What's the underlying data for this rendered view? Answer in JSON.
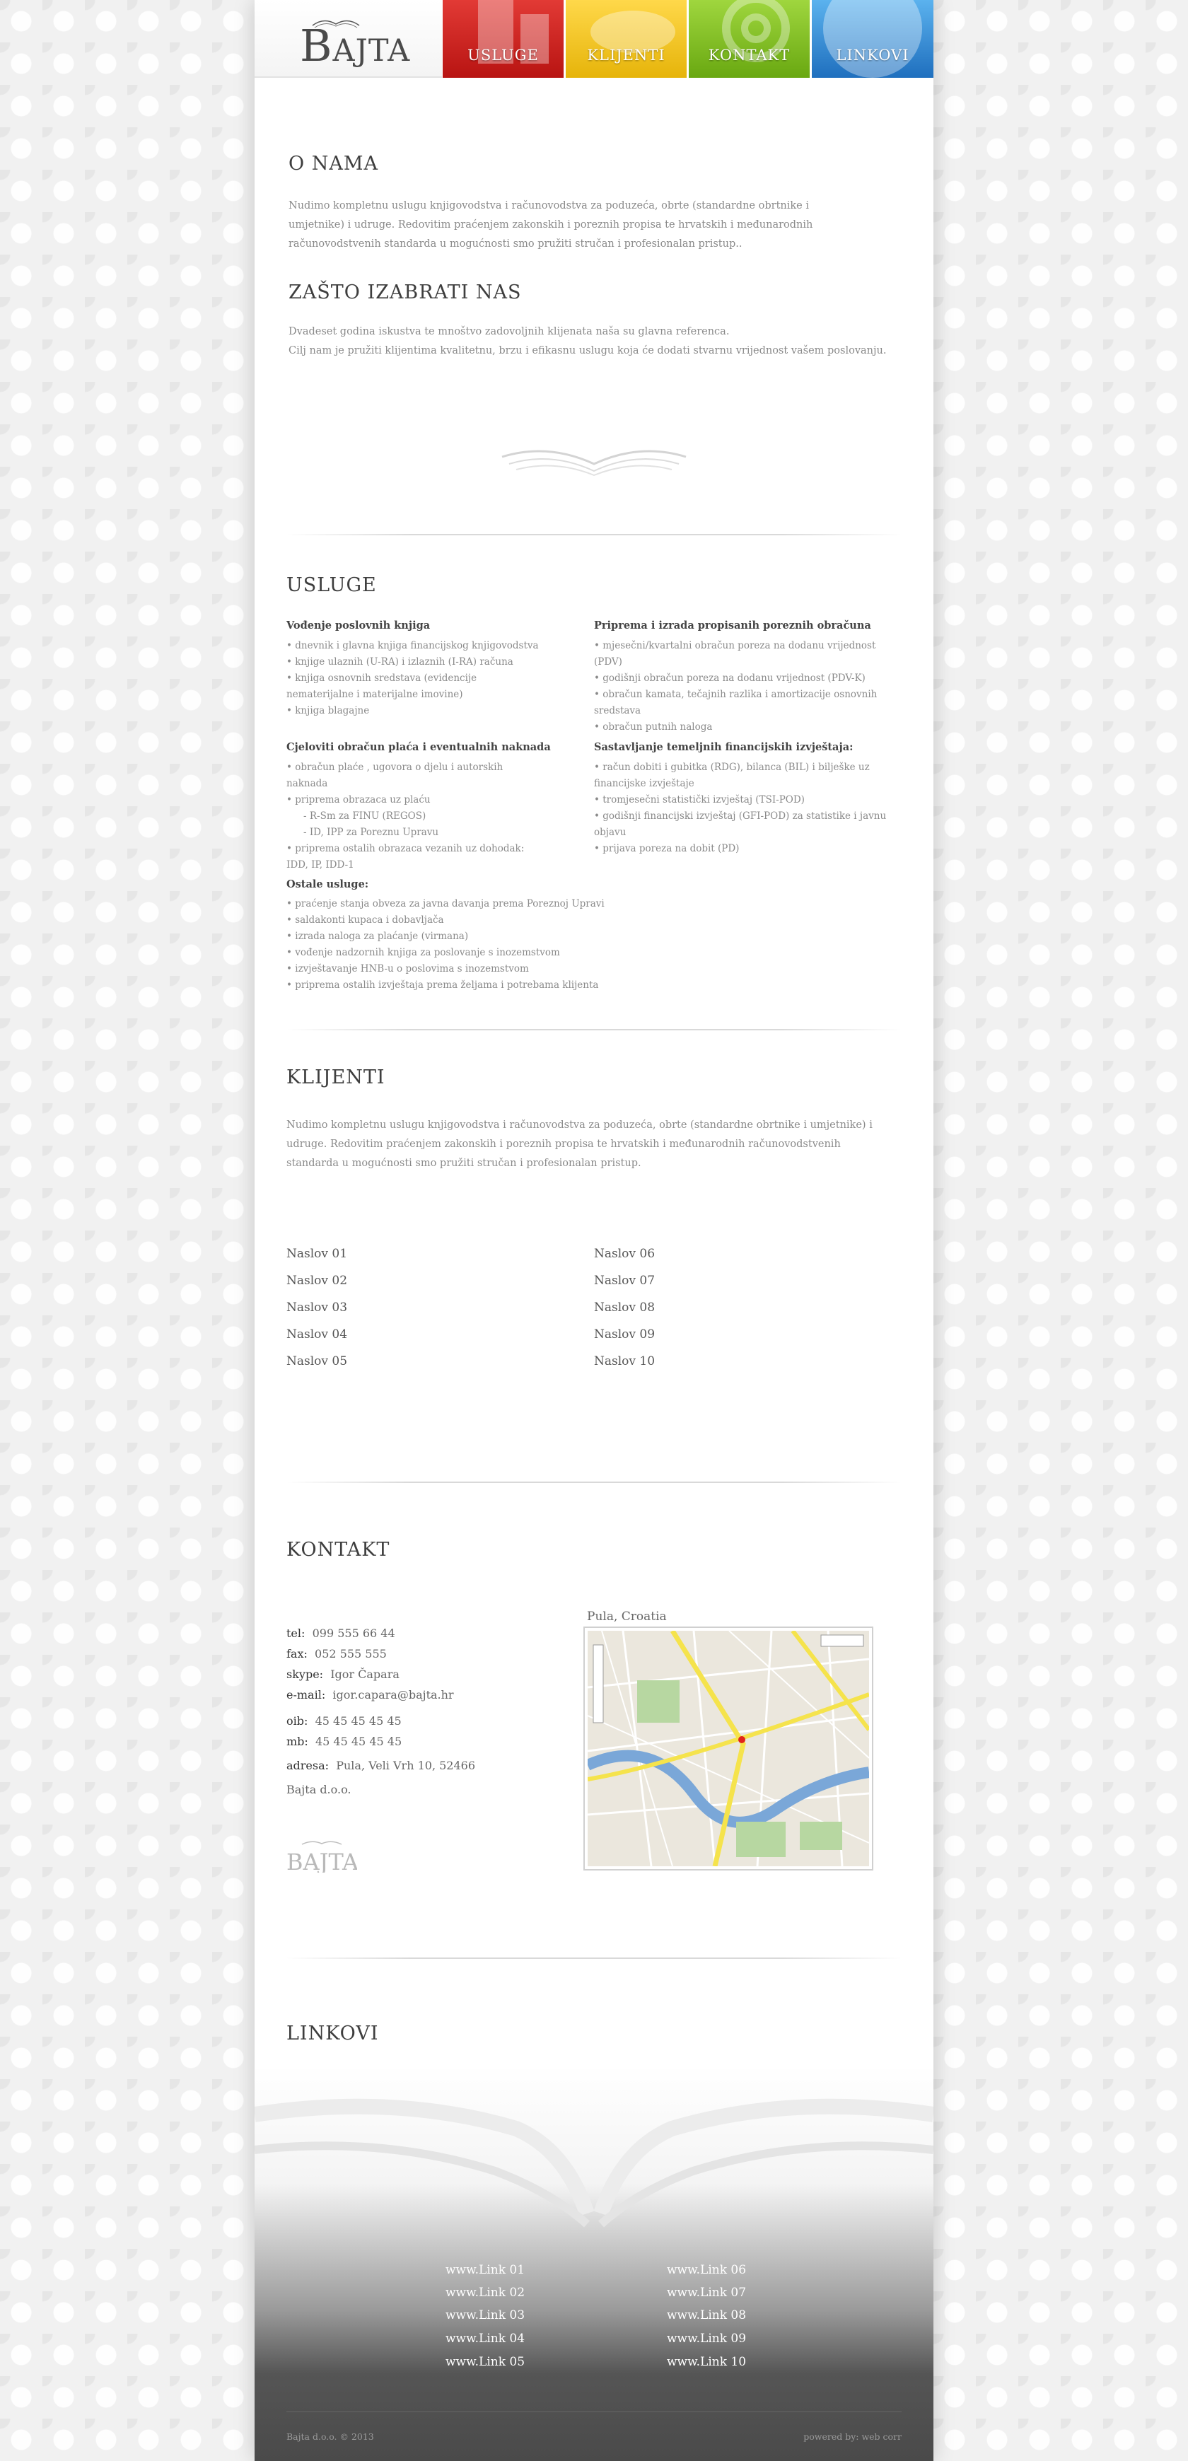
{
  "brand": {
    "logo_text": "Bajta"
  },
  "nav": [
    {
      "label": "USLUGE"
    },
    {
      "label": "KLIJENTI"
    },
    {
      "label": "KONTAKT"
    },
    {
      "label": "LINKOVI"
    }
  ],
  "about": {
    "title": "O NAMA",
    "text": "Nudimo kompletnu uslugu knjigovodstva i računovodstva za poduzeća, obrte (standardne obrtnike i umjetnike) i udruge. Redovitim praćenjem zakonskih i poreznih propisa te hrvatskih i međunarodnih računovodstvenih standarda u mogućnosti smo pružiti stručan i profesionalan pristup..",
    "why_title": "ZAŠTO IZABRATI NAS",
    "why_line1": "Dvadeset godina iskustva te mnoštvo zadovoljnih klijenata naša su glavna referenca.",
    "why_line2": "Cilj nam je pružiti klijentima kvalitetnu, brzu i efikasnu uslugu koja će dodati stvarnu vrijednost vašem poslovanju."
  },
  "usluge": {
    "title": "USLUGE",
    "groups": [
      {
        "heading": "Vođenje poslovnih knjiga",
        "items": [
          "• dnevnik i glavna knjiga financijskog knjigovodstva",
          "• knjige ulaznih (U-RA) i izlaznih (I-RA) računa",
          "• knjiga osnovnih sredstava (evidencije nematerijalne i materijalne imovine)",
          "• knjiga blagajne"
        ]
      },
      {
        "heading": "Priprema i izrada propisanih poreznih obračuna",
        "items": [
          "• mjesečni/kvartalni obračun poreza na dodanu vrijednost (PDV)",
          "• godišnji obračun poreza na dodanu vrijednost (PDV-K)",
          "• obračun kamata, tečajnih razlika i amortizacije osnovnih sredstava",
          "• obračun putnih naloga"
        ]
      },
      {
        "heading": "Cjeloviti obračun plaća i eventualnih naknada",
        "items": [
          "• obračun plaće , ugovora o djelu i autorskih naknada",
          "• priprema obrazaca uz plaću",
          "- R-Sm za FINU (REGOS)",
          "- ID, IPP za Poreznu Upravu",
          "• priprema ostalih obrazaca vezanih uz dohodak: IDD, IP, IDD-1"
        ]
      },
      {
        "heading": "Sastavljanje temeljnih financijskih izvještaja:",
        "items": [
          "• račun dobiti i gubitka (RDG), bilanca (BIL) i bilješke uz financijske izvještaje",
          "• tromjesečni statistički izvještaj (TSI-POD)",
          "• godišnji financijski izvještaj (GFI-POD) za statistike i javnu objavu",
          "• prijava poreza na dobit (PD)"
        ]
      },
      {
        "heading": "Ostale usluge:",
        "items": [
          "• praćenje stanja obveza za javna davanja prema Poreznoj Upravi",
          "• saldakonti kupaca i dobavljača",
          "• izrada naloga za plaćanje (virmana)",
          "• vođenje nadzornih knjiga za poslovanje s inozemstvom",
          "• izvještavanje HNB-u o poslovima s inozemstvom",
          "• priprema ostalih izvještaja prema željama i potrebama klijenta"
        ]
      }
    ]
  },
  "klijenti": {
    "title": "KLIJENTI",
    "text": "Nudimo kompletnu uslugu knjigovodstva i računovodstva za poduzeća, obrte (standardne obrtnike i umjetnike) i udruge. Redovitim praćenjem zakonskih i poreznih propisa te hrvatskih i međunarodnih računovodstvenih standarda u mogućnosti smo pružiti stručan i profesionalan pristup.",
    "links": [
      "Naslov 01",
      "Naslov 02",
      "Naslov 03",
      "Naslov 04",
      "Naslov 05",
      "Naslov 06",
      "Naslov 07",
      "Naslov 08",
      "Naslov 09",
      "Naslov 10"
    ]
  },
  "kontakt": {
    "title": "KONTAKT",
    "tel_label": "tel:",
    "tel": "099 555 66 44",
    "fax_label": "fax:",
    "fax": "052 555 555",
    "skype_label": "skype:",
    "skype": "Igor Čapara",
    "email_label": "e-mail:",
    "email": "igor.capara@bajta.hr",
    "oib_label": "oib:",
    "oib": "45 45 45 45 45",
    "mb_label": "mb:",
    "mb": "45 45 45 45 45",
    "adresa_label": "adresa:",
    "adresa": "Pula, Veli Vrh 10, 52466",
    "company": "Bajta d.o.o.",
    "map_caption": "Pula, Croatia"
  },
  "linkovi": {
    "title": "LINKOVI",
    "links": [
      "www.Link 01",
      "www.Link 02",
      "www.Link 03",
      "www.Link 04",
      "www.Link 05",
      "www.Link 06",
      "www.Link 07",
      "www.Link 08",
      "www.Link 09",
      "www.Link 10"
    ]
  },
  "footer": {
    "copyright": "Bajta d.o.o. © 2013",
    "powered": "powered by: web corr"
  }
}
